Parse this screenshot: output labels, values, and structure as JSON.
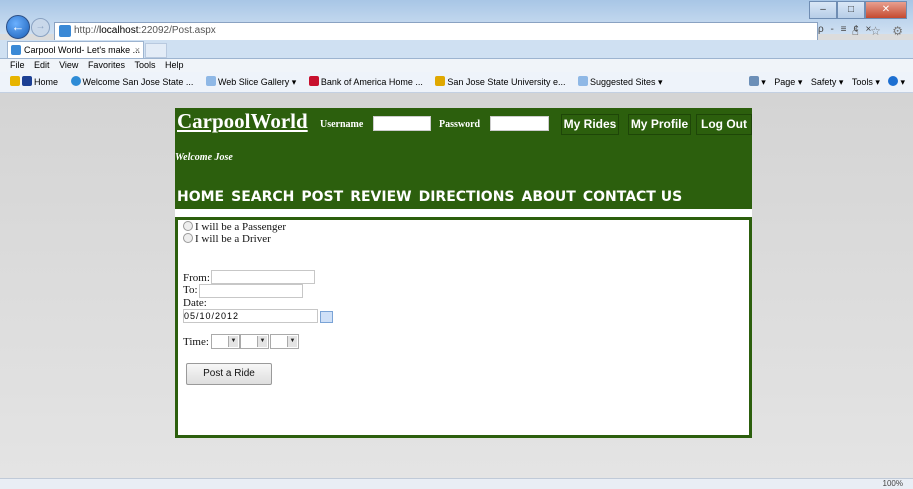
{
  "browser": {
    "url_prefix": "http://",
    "url_host": "localhost",
    "url_rest": ":22092/Post.aspx",
    "tab_title": "Carpool World- Let's make ...",
    "tab_close": "×",
    "window_buttons": {
      "minimize": "–",
      "maximize": "□",
      "close": "✕"
    },
    "nav_back": "←",
    "nav_forward": "→",
    "addr_tools": "ρ - ≡ ¢ ×",
    "right_tools": "⌂ ☆ ⚙",
    "menu": [
      "File",
      "Edit",
      "View",
      "Favorites",
      "Tools",
      "Help"
    ],
    "favorites": [
      "Home",
      "Welcome San Jose State ...",
      "Web Slice Gallery ▾",
      "Bank of America Home ...",
      "San Jose State University e...",
      "Suggested Sites ▾"
    ],
    "command_bar": [
      "▾",
      "Page ▾",
      "Safety ▾",
      "Tools ▾",
      "▾"
    ],
    "zoom": "100%"
  },
  "site": {
    "brand": "CarpoolWorld",
    "username_label": "Username",
    "password_label": "Password",
    "buttons": {
      "my_rides": "My Rides",
      "my_profile": "My Profile",
      "log_out": "Log Out"
    },
    "welcome": "Welcome Jose",
    "nav": [
      "HOME",
      "SEARCH",
      "POST",
      "REVIEW",
      "DIRECTIONS",
      "ABOUT",
      "CONTACT US"
    ]
  },
  "form": {
    "radio_passenger": "I will be a Passenger",
    "radio_driver": "I will be a Driver",
    "from_label": "From:",
    "to_label": "To:",
    "date_label": "Date:",
    "date_value": "05/10/2012",
    "time_label": "Time:",
    "submit_label": "Post a Ride"
  }
}
